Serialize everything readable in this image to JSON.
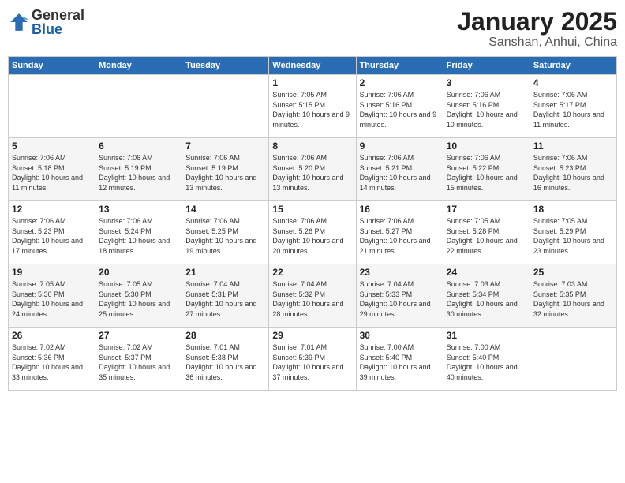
{
  "logo": {
    "text_general": "General",
    "text_blue": "Blue"
  },
  "header": {
    "month": "January 2025",
    "location": "Sanshan, Anhui, China"
  },
  "weekdays": [
    "Sunday",
    "Monday",
    "Tuesday",
    "Wednesday",
    "Thursday",
    "Friday",
    "Saturday"
  ],
  "weeks": [
    {
      "days": [
        {
          "num": "",
          "sunrise": "",
          "sunset": "",
          "daylight": ""
        },
        {
          "num": "",
          "sunrise": "",
          "sunset": "",
          "daylight": ""
        },
        {
          "num": "",
          "sunrise": "",
          "sunset": "",
          "daylight": ""
        },
        {
          "num": "1",
          "sunrise": "Sunrise: 7:05 AM",
          "sunset": "Sunset: 5:15 PM",
          "daylight": "Daylight: 10 hours and 9 minutes."
        },
        {
          "num": "2",
          "sunrise": "Sunrise: 7:06 AM",
          "sunset": "Sunset: 5:16 PM",
          "daylight": "Daylight: 10 hours and 9 minutes."
        },
        {
          "num": "3",
          "sunrise": "Sunrise: 7:06 AM",
          "sunset": "Sunset: 5:16 PM",
          "daylight": "Daylight: 10 hours and 10 minutes."
        },
        {
          "num": "4",
          "sunrise": "Sunrise: 7:06 AM",
          "sunset": "Sunset: 5:17 PM",
          "daylight": "Daylight: 10 hours and 11 minutes."
        }
      ]
    },
    {
      "days": [
        {
          "num": "5",
          "sunrise": "Sunrise: 7:06 AM",
          "sunset": "Sunset: 5:18 PM",
          "daylight": "Daylight: 10 hours and 11 minutes."
        },
        {
          "num": "6",
          "sunrise": "Sunrise: 7:06 AM",
          "sunset": "Sunset: 5:19 PM",
          "daylight": "Daylight: 10 hours and 12 minutes."
        },
        {
          "num": "7",
          "sunrise": "Sunrise: 7:06 AM",
          "sunset": "Sunset: 5:19 PM",
          "daylight": "Daylight: 10 hours and 13 minutes."
        },
        {
          "num": "8",
          "sunrise": "Sunrise: 7:06 AM",
          "sunset": "Sunset: 5:20 PM",
          "daylight": "Daylight: 10 hours and 13 minutes."
        },
        {
          "num": "9",
          "sunrise": "Sunrise: 7:06 AM",
          "sunset": "Sunset: 5:21 PM",
          "daylight": "Daylight: 10 hours and 14 minutes."
        },
        {
          "num": "10",
          "sunrise": "Sunrise: 7:06 AM",
          "sunset": "Sunset: 5:22 PM",
          "daylight": "Daylight: 10 hours and 15 minutes."
        },
        {
          "num": "11",
          "sunrise": "Sunrise: 7:06 AM",
          "sunset": "Sunset: 5:23 PM",
          "daylight": "Daylight: 10 hours and 16 minutes."
        }
      ]
    },
    {
      "days": [
        {
          "num": "12",
          "sunrise": "Sunrise: 7:06 AM",
          "sunset": "Sunset: 5:23 PM",
          "daylight": "Daylight: 10 hours and 17 minutes."
        },
        {
          "num": "13",
          "sunrise": "Sunrise: 7:06 AM",
          "sunset": "Sunset: 5:24 PM",
          "daylight": "Daylight: 10 hours and 18 minutes."
        },
        {
          "num": "14",
          "sunrise": "Sunrise: 7:06 AM",
          "sunset": "Sunset: 5:25 PM",
          "daylight": "Daylight: 10 hours and 19 minutes."
        },
        {
          "num": "15",
          "sunrise": "Sunrise: 7:06 AM",
          "sunset": "Sunset: 5:26 PM",
          "daylight": "Daylight: 10 hours and 20 minutes."
        },
        {
          "num": "16",
          "sunrise": "Sunrise: 7:06 AM",
          "sunset": "Sunset: 5:27 PM",
          "daylight": "Daylight: 10 hours and 21 minutes."
        },
        {
          "num": "17",
          "sunrise": "Sunrise: 7:05 AM",
          "sunset": "Sunset: 5:28 PM",
          "daylight": "Daylight: 10 hours and 22 minutes."
        },
        {
          "num": "18",
          "sunrise": "Sunrise: 7:05 AM",
          "sunset": "Sunset: 5:29 PM",
          "daylight": "Daylight: 10 hours and 23 minutes."
        }
      ]
    },
    {
      "days": [
        {
          "num": "19",
          "sunrise": "Sunrise: 7:05 AM",
          "sunset": "Sunset: 5:30 PM",
          "daylight": "Daylight: 10 hours and 24 minutes."
        },
        {
          "num": "20",
          "sunrise": "Sunrise: 7:05 AM",
          "sunset": "Sunset: 5:30 PM",
          "daylight": "Daylight: 10 hours and 25 minutes."
        },
        {
          "num": "21",
          "sunrise": "Sunrise: 7:04 AM",
          "sunset": "Sunset: 5:31 PM",
          "daylight": "Daylight: 10 hours and 27 minutes."
        },
        {
          "num": "22",
          "sunrise": "Sunrise: 7:04 AM",
          "sunset": "Sunset: 5:32 PM",
          "daylight": "Daylight: 10 hours and 28 minutes."
        },
        {
          "num": "23",
          "sunrise": "Sunrise: 7:04 AM",
          "sunset": "Sunset: 5:33 PM",
          "daylight": "Daylight: 10 hours and 29 minutes."
        },
        {
          "num": "24",
          "sunrise": "Sunrise: 7:03 AM",
          "sunset": "Sunset: 5:34 PM",
          "daylight": "Daylight: 10 hours and 30 minutes."
        },
        {
          "num": "25",
          "sunrise": "Sunrise: 7:03 AM",
          "sunset": "Sunset: 5:35 PM",
          "daylight": "Daylight: 10 hours and 32 minutes."
        }
      ]
    },
    {
      "days": [
        {
          "num": "26",
          "sunrise": "Sunrise: 7:02 AM",
          "sunset": "Sunset: 5:36 PM",
          "daylight": "Daylight: 10 hours and 33 minutes."
        },
        {
          "num": "27",
          "sunrise": "Sunrise: 7:02 AM",
          "sunset": "Sunset: 5:37 PM",
          "daylight": "Daylight: 10 hours and 35 minutes."
        },
        {
          "num": "28",
          "sunrise": "Sunrise: 7:01 AM",
          "sunset": "Sunset: 5:38 PM",
          "daylight": "Daylight: 10 hours and 36 minutes."
        },
        {
          "num": "29",
          "sunrise": "Sunrise: 7:01 AM",
          "sunset": "Sunset: 5:39 PM",
          "daylight": "Daylight: 10 hours and 37 minutes."
        },
        {
          "num": "30",
          "sunrise": "Sunrise: 7:00 AM",
          "sunset": "Sunset: 5:40 PM",
          "daylight": "Daylight: 10 hours and 39 minutes."
        },
        {
          "num": "31",
          "sunrise": "Sunrise: 7:00 AM",
          "sunset": "Sunset: 5:40 PM",
          "daylight": "Daylight: 10 hours and 40 minutes."
        },
        {
          "num": "",
          "sunrise": "",
          "sunset": "",
          "daylight": ""
        }
      ]
    }
  ]
}
